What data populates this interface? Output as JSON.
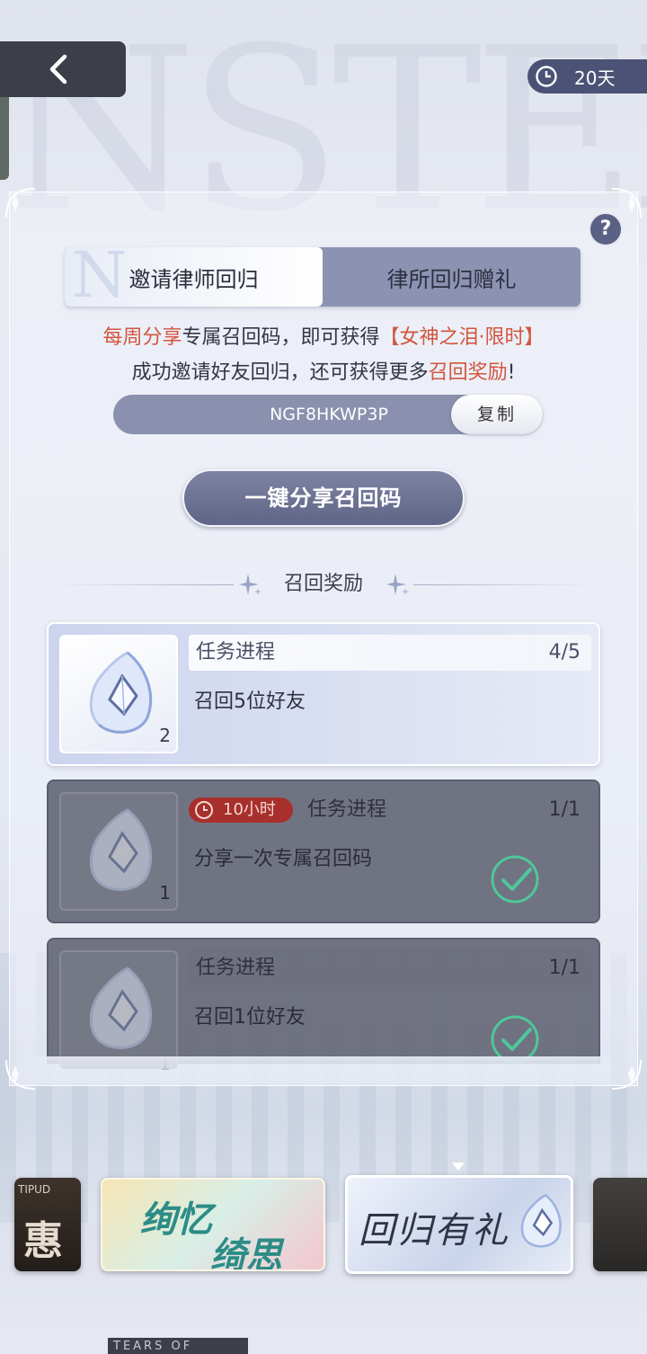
{
  "top": {
    "timer_text": "20天"
  },
  "background": {
    "letters": "NSTEL"
  },
  "tabs": [
    {
      "label": "邀请律师回归",
      "active": true
    },
    {
      "label": "律所回归赠礼",
      "active": false
    }
  ],
  "description": {
    "line1_red_a": "每周分享",
    "line1_normal": "专属召回码，即可获得",
    "line1_red_b": "【女神之泪·限时】",
    "line2_normal": "成功邀请好友回归，还可获得更多",
    "line2_red": "召回奖励",
    "line2_end": "!"
  },
  "code_bar": {
    "code": "NGF8HKWP3P",
    "copy_label": "复制"
  },
  "share_button_label": "一键分享召回码",
  "section_title": "召回奖励",
  "tasks": [
    {
      "progress_label": "任务进程",
      "progress": "4/5",
      "task": "召回5位好友",
      "quantity": "2",
      "status": "in-progress"
    },
    {
      "progress_label": "任务进程",
      "progress": "1/1",
      "task": "分享一次专属召回码",
      "quantity": "1",
      "status": "completed",
      "timer": "10小时"
    },
    {
      "progress_label": "任务进程",
      "progress": "1/1",
      "task": "召回1位好友",
      "quantity": "1",
      "status": "completed"
    }
  ],
  "event_cards": [
    {
      "small": "TIPUD",
      "title": "惠"
    },
    {
      "line1": "绚忆",
      "line2": "绮思"
    },
    {
      "title": "回归有礼",
      "selected": true
    }
  ],
  "footer": {
    "logo_text": "TEARS OF"
  },
  "colors": {
    "accent_red": "#d2553e",
    "panel_dark": "#5f6586",
    "check_green": "#4fc79a",
    "timer_red": "#a8302c"
  },
  "icons": {
    "back": "chevron-left-icon",
    "timer": "clock-icon",
    "help": "question-icon",
    "reward": "crystal-tear-icon",
    "done": "checkmark-icon"
  }
}
